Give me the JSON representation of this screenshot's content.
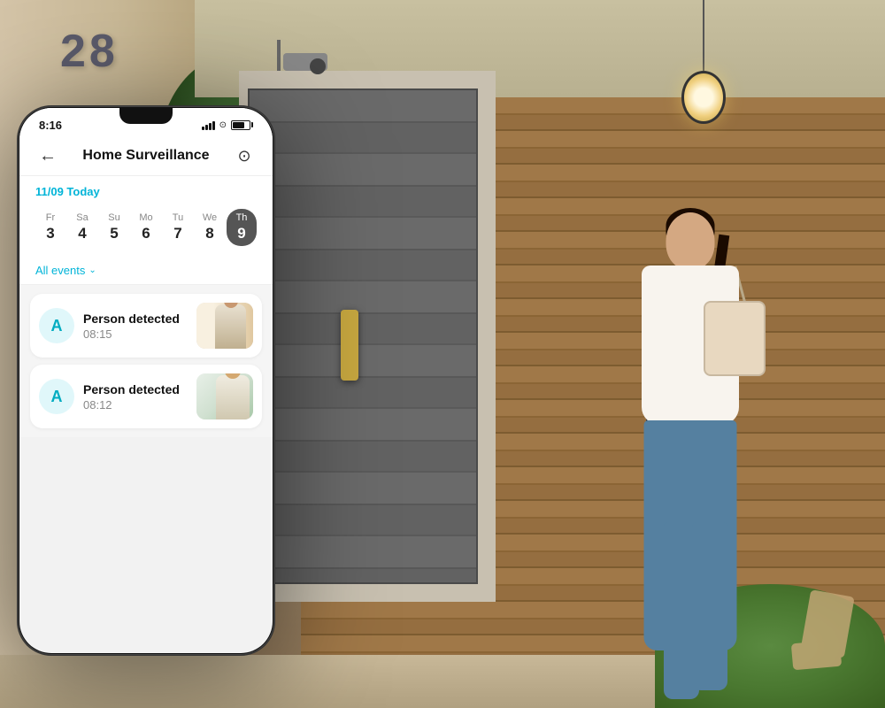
{
  "scene": {
    "house_number": "28"
  },
  "phone": {
    "status_bar": {
      "time": "8:16",
      "signal_label": "signal",
      "wifi_label": "wifi",
      "battery_label": "battery"
    },
    "nav": {
      "back_label": "←",
      "title": "Home Surveillance",
      "icon_label": "⊙"
    },
    "date_header": {
      "label": "11/09 Today"
    },
    "days": [
      {
        "name": "Fr",
        "num": "3",
        "active": false
      },
      {
        "name": "Sa",
        "num": "4",
        "active": false
      },
      {
        "name": "Su",
        "num": "5",
        "active": false
      },
      {
        "name": "Mo",
        "num": "6",
        "active": false
      },
      {
        "name": "Tu",
        "num": "7",
        "active": false
      },
      {
        "name": "We",
        "num": "8",
        "active": false
      },
      {
        "name": "Th",
        "num": "9",
        "active": true
      }
    ],
    "filter": {
      "label": "All events",
      "chevron": "⌄"
    },
    "events": [
      {
        "id": "event-1",
        "avatar_letter": "A",
        "title": "Person detected",
        "time": "08:15"
      },
      {
        "id": "event-2",
        "avatar_letter": "A",
        "title": "Person detected",
        "time": "08:12"
      }
    ]
  }
}
